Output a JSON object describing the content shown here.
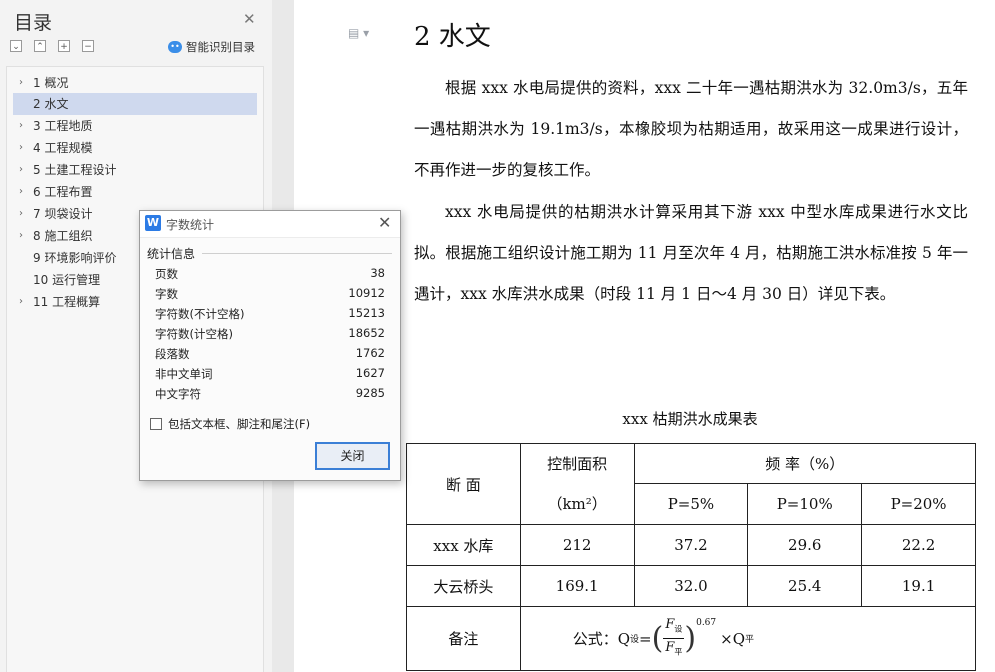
{
  "sidebar": {
    "title": "目录",
    "smart_label": "智能识别目录",
    "items": [
      {
        "label": "1 概况",
        "arrow": "›"
      },
      {
        "label": "2 水文",
        "arrow": ""
      },
      {
        "label": "3 工程地质",
        "arrow": "›"
      },
      {
        "label": "4 工程规模",
        "arrow": "›"
      },
      {
        "label": "5 土建工程设计",
        "arrow": "›"
      },
      {
        "label": "6 工程布置",
        "arrow": "›"
      },
      {
        "label": "7 坝袋设计",
        "arrow": "›"
      },
      {
        "label": "8 施工组织",
        "arrow": "›"
      },
      {
        "label": "9 环境影响评价",
        "arrow": ""
      },
      {
        "label": "10 运行管理",
        "arrow": ""
      },
      {
        "label": "11 工程概算",
        "arrow": "›"
      }
    ]
  },
  "document": {
    "heading": "2 水文",
    "paragraphs": [
      "根据 xxx 水电局提供的资料，xxx 二十年一遇枯期洪水为 32.0m3/s，五年一遇枯期洪水为 19.1m3/s，本橡胶坝为枯期适用，故采用这一成果进行设计，不再作进一步的复核工作。",
      "xxx 水电局提供的枯期洪水计算采用其下游 xxx 中型水库成果进行水文比拟。根据施工组织设计施工期为 11 月至次年 4 月，枯期施工洪水标准按 5 年一遇计，xxx 水库洪水成果（时段 11 月 1 日～4 月 30 日）详见下表。"
    ],
    "table": {
      "title": "xxx 枯期洪水成果表",
      "header_section": "断 面",
      "header_area": "控制面积",
      "header_area_unit": "（km²）",
      "header_freq": "频 率（%）",
      "freq_cols": [
        "P=5%",
        "P=10%",
        "P=20%"
      ],
      "rows": [
        {
          "name": "xxx 水库",
          "area": "212",
          "p5": "37.2",
          "p10": "29.6",
          "p20": "22.2"
        },
        {
          "name": "大云桥头",
          "area": "169.1",
          "p5": "32.0",
          "p10": "25.4",
          "p20": "19.1"
        }
      ],
      "remark_label": "备注",
      "formula_prefix": "公式：Q",
      "formula_sub1": "设",
      "formula_eq": "=",
      "formula_num": "F",
      "formula_num_sub": "设",
      "formula_den": "F",
      "formula_den_sub": "平",
      "formula_exp": "0.67",
      "formula_times": "×Q",
      "formula_sub2": "平"
    }
  },
  "dialog": {
    "title": "字数统计",
    "section_label": "统计信息",
    "stats": [
      {
        "label": "页数",
        "value": "38"
      },
      {
        "label": "字数",
        "value": "10912"
      },
      {
        "label": "字符数(不计空格)",
        "value": "15213"
      },
      {
        "label": "字符数(计空格)",
        "value": "18652"
      },
      {
        "label": "段落数",
        "value": "1762"
      },
      {
        "label": "非中文单词",
        "value": "1627"
      },
      {
        "label": "中文字符",
        "value": "9285"
      }
    ],
    "checkbox_label": "包括文本框、脚注和尾注(F)",
    "close_button": "关闭"
  }
}
